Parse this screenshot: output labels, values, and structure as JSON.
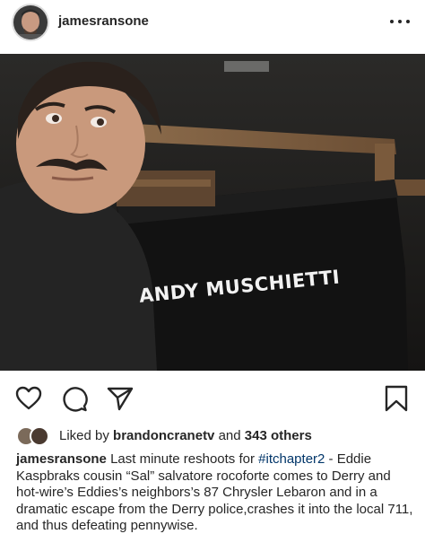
{
  "post": {
    "username": "james​ransone",
    "more_icon": "more-horizontal-icon"
  },
  "photo": {
    "chair_label": "ANDY MUSCHIETTI"
  },
  "actions": {
    "like_icon": "heart-icon",
    "comment_icon": "comment-icon",
    "share_icon": "send-icon",
    "save_icon": "bookmark-icon"
  },
  "likes": {
    "prefix": "Liked by",
    "user": "brandoncranetv",
    "joiner": "and",
    "others": "343 others"
  },
  "caption": {
    "username": "jamesransone",
    "text_before": "Last minute reshoots for",
    "hashtag": "#itchapter2",
    "text_after": "- Eddie Kaspbraks cousin “Sal” salvatore rocoforte comes to Derry and hot-wire’s Eddies’s neighbors’s 87 Chrysler Lebaron and in a dramatic escape from the Derry police,crashes it into the local 711, and thus defeating pennywise."
  },
  "colors": {
    "text": "#262626",
    "hashtag": "#003569",
    "background": "#ffffff"
  }
}
